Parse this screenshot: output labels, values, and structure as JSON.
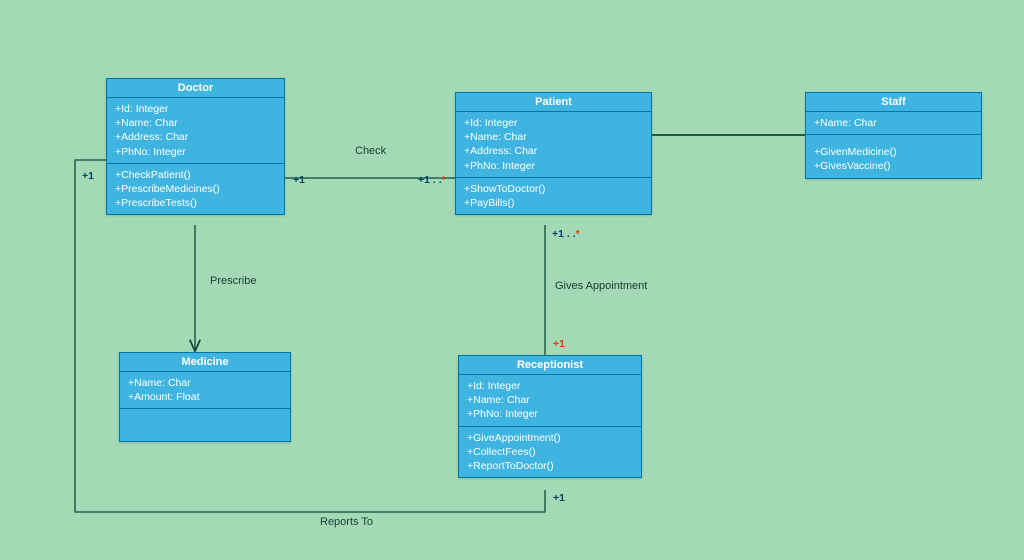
{
  "classes": {
    "doctor": {
      "title": "Doctor",
      "attrs": [
        "+Id: Integer",
        "+Name: Char",
        "+Address: Char",
        "+PhNo: Integer"
      ],
      "methods": [
        "+CheckPatient()",
        "+PrescribeMedicines()",
        "+PrescribeTests()"
      ]
    },
    "patient": {
      "title": "Patient",
      "attrs": [
        "+Id: Integer",
        "+Name: Char",
        "+Address: Char",
        "+PhNo: Integer"
      ],
      "methods": [
        "+ShowToDoctor()",
        "+PayBills()"
      ]
    },
    "staff": {
      "title": "Staff",
      "attrs": [
        "+Name: Char"
      ],
      "methods": [
        "+GivenMedicine()",
        "+GivesVaccine()"
      ]
    },
    "medicine": {
      "title": "Medicine",
      "attrs": [
        "+Name: Char",
        "+Amount: Float"
      ],
      "methods": []
    },
    "receptionist": {
      "title": "Receptionist",
      "attrs": [
        "+Id: Integer",
        "+Name: Char",
        "+PhNo: Integer"
      ],
      "methods": [
        "+GiveAppointment()",
        "+CollectFees()",
        "+ReportToDoctor()"
      ]
    }
  },
  "labels": {
    "check": "Check",
    "prescribe": "Prescribe",
    "givesAppointment": "Gives Appointment",
    "reportsTo": "Reports To"
  },
  "mults": {
    "doctor_left": "+1",
    "doctor_right": "+1",
    "patient_left": "+1 . .",
    "patient_bottom": "+1 . .",
    "recept_top": "+1",
    "recept_bottom": "+1"
  },
  "chart_data": {
    "type": "table",
    "diagram_type": "UML Class Diagram",
    "classes": [
      {
        "name": "Doctor",
        "attributes": [
          "Id: Integer",
          "Name: Char",
          "Address: Char",
          "PhNo: Integer"
        ],
        "operations": [
          "CheckPatient()",
          "PrescribeMedicines()",
          "PrescribeTests()"
        ]
      },
      {
        "name": "Patient",
        "attributes": [
          "Id: Integer",
          "Name: Char",
          "Address: Char",
          "PhNo: Integer"
        ],
        "operations": [
          "ShowToDoctor()",
          "PayBills()"
        ]
      },
      {
        "name": "Staff",
        "attributes": [
          "Name: Char"
        ],
        "operations": [
          "GivenMedicine()",
          "GivesVaccine()"
        ]
      },
      {
        "name": "Medicine",
        "attributes": [
          "Name: Char",
          "Amount: Float"
        ],
        "operations": []
      },
      {
        "name": "Receptionist",
        "attributes": [
          "Id: Integer",
          "Name: Char",
          "PhNo: Integer"
        ],
        "operations": [
          "GiveAppointment()",
          "CollectFees()",
          "ReportToDoctor()"
        ]
      }
    ],
    "associations": [
      {
        "from": "Doctor",
        "to": "Patient",
        "label": "Check",
        "from_mult": "1",
        "to_mult": "1..*"
      },
      {
        "from": "Doctor",
        "to": "Medicine",
        "label": "Prescribe",
        "directed": true
      },
      {
        "from": "Patient",
        "to": "Receptionist",
        "label": "Gives Appointment",
        "from_mult": "1..*",
        "to_mult": "1"
      },
      {
        "from": "Receptionist",
        "to": "Doctor",
        "label": "Reports To",
        "from_mult": "1",
        "to_mult": "1"
      },
      {
        "from": "Patient",
        "to": "Staff"
      }
    ]
  }
}
